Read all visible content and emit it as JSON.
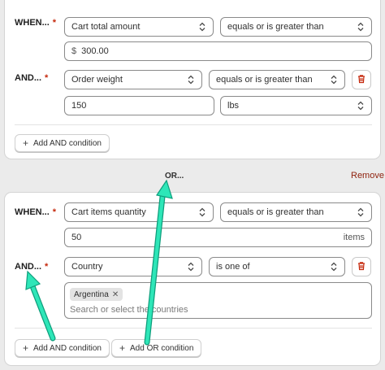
{
  "group1": {
    "when_label": "WHEN...",
    "and_label": "AND...",
    "required_mark": "*",
    "cond1": {
      "field": "Cart total amount",
      "operator": "equals or is greater than",
      "value_prefix": "$",
      "value": "300.00"
    },
    "cond2": {
      "field": "Order weight",
      "operator": "equals or is greater than",
      "value": "150",
      "unit": "lbs"
    },
    "add_and_label": "Add AND condition"
  },
  "or_separator": "OR...",
  "remove_label": "Remove",
  "group2": {
    "when_label": "WHEN...",
    "and_label": "AND...",
    "required_mark": "*",
    "cond1": {
      "field": "Cart items quantity",
      "operator": "equals or is greater than",
      "value": "50",
      "value_suffix": "items"
    },
    "cond2": {
      "field": "Country",
      "operator": "is one of",
      "tags": [
        "Argentina"
      ],
      "search_placeholder": "Search or select the countries"
    },
    "add_and_label": "Add AND condition",
    "add_or_label": "Add OR condition"
  },
  "colors": {
    "required": "#c5280c",
    "remove": "#8e1f0b",
    "annotation_arrow": "#2ee6b8"
  },
  "icons": {
    "select_chevron": "chevron-up-down-icon",
    "delete": "trash-icon",
    "add": "plus-icon",
    "tag_remove": "close-icon"
  }
}
